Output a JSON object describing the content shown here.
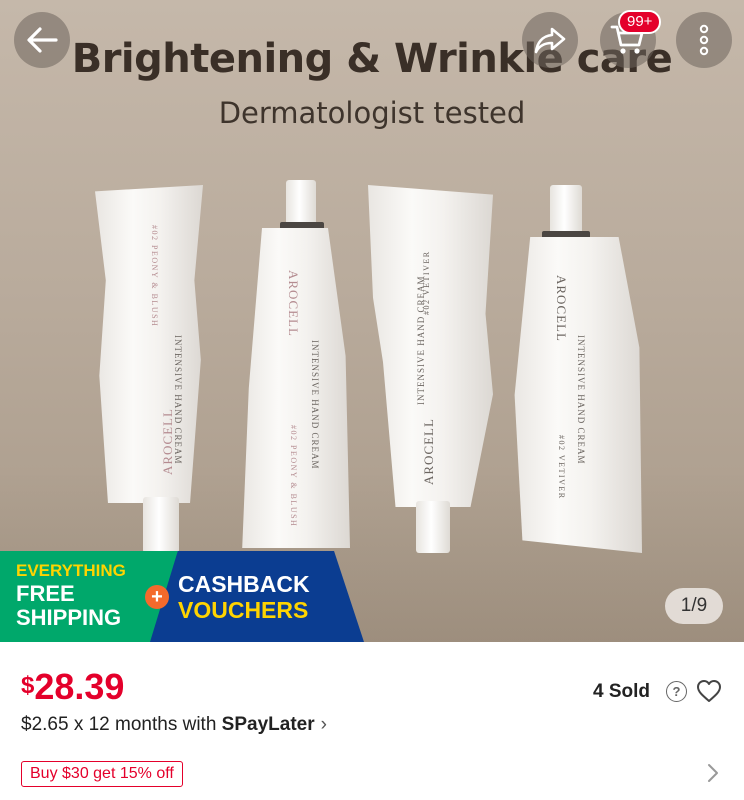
{
  "hero": {
    "title": "Brightening & Wrinkle care",
    "subtitle": "Dermatologist tested",
    "tubes": [
      {
        "brand": "AROCELL",
        "product": "INTENSIVE HAND CREAM",
        "scent": "#02 PEONY & BLUSH"
      },
      {
        "brand": "AROCELL",
        "product": "INTENSIVE HAND CREAM",
        "scent": "#02 PEONY & BLUSH"
      },
      {
        "brand": "AROCELL",
        "product": "INTENSIVE HAND CREAM",
        "scent": "#02 VETIVER"
      },
      {
        "brand": "AROCELL",
        "product": "INTENSIVE HAND CREAM",
        "scent": "#02 VETIVER"
      }
    ]
  },
  "nav": {
    "back_icon": "back-arrow-icon",
    "share_icon": "share-icon",
    "cart_icon": "cart-icon",
    "cart_badge": "99+",
    "more_icon": "more-vertical-icon"
  },
  "promo": {
    "line1": "EVERYTHING",
    "line2": "FREE",
    "line3": "SHIPPING",
    "plus": "+",
    "right1": "CASHBACK",
    "right2": "VOUCHERS"
  },
  "gallery": {
    "pager": "1/9"
  },
  "product": {
    "currency": "$",
    "price": "28.39",
    "sold": "4 Sold",
    "help": "?",
    "installment_prefix": "$2.65 x 12 months with ",
    "installment_brand": "SPayLater",
    "installment_chevron": "›",
    "deal": "Buy $30 get 15% off"
  },
  "colors": {
    "price_red": "#e4002b",
    "promo_green": "#00a86b",
    "promo_blue": "#0b3d91",
    "promo_yellow": "#ffd400",
    "plus_orange": "#f46a2c"
  }
}
